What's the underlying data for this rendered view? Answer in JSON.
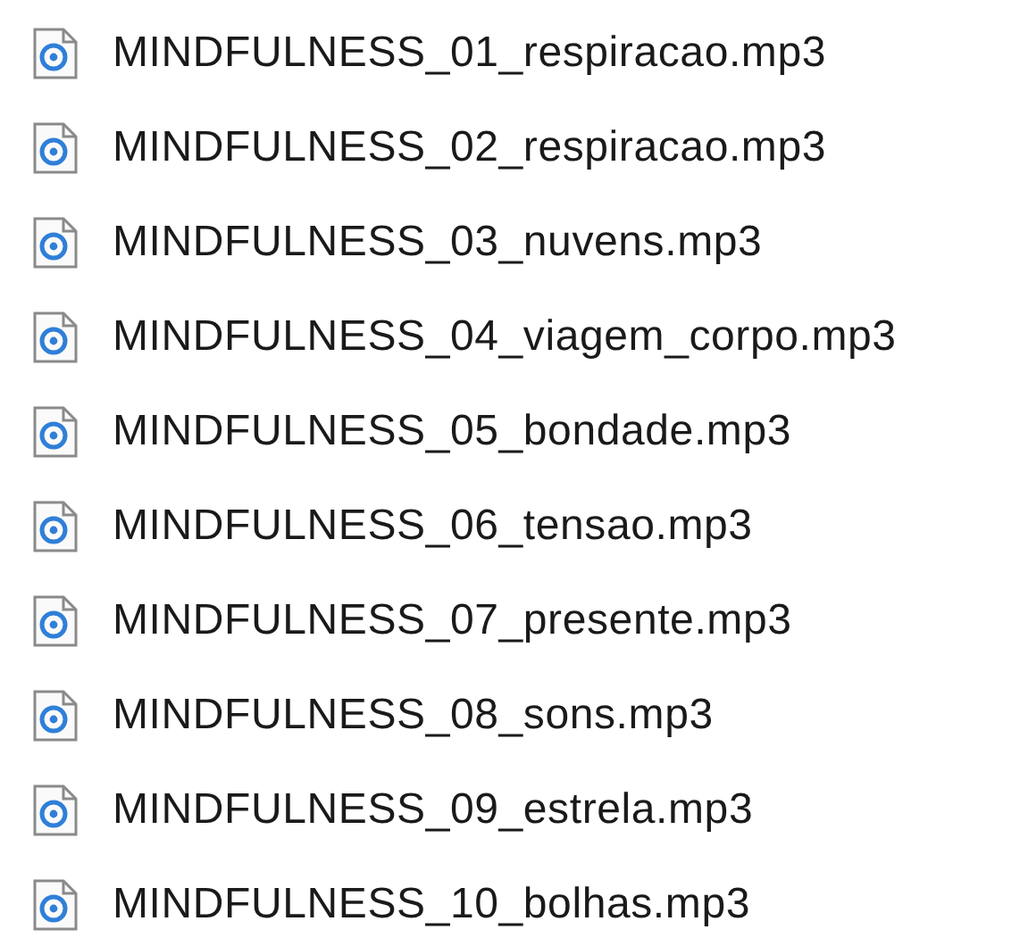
{
  "files": [
    {
      "name": "MINDFULNESS_01_respiracao.mp3"
    },
    {
      "name": "MINDFULNESS_02_respiracao.mp3"
    },
    {
      "name": "MINDFULNESS_03_nuvens.mp3"
    },
    {
      "name": "MINDFULNESS_04_viagem_corpo.mp3"
    },
    {
      "name": "MINDFULNESS_05_bondade.mp3"
    },
    {
      "name": "MINDFULNESS_06_tensao.mp3"
    },
    {
      "name": "MINDFULNESS_07_presente.mp3"
    },
    {
      "name": "MINDFULNESS_08_sons.mp3"
    },
    {
      "name": "MINDFULNESS_09_estrela.mp3"
    },
    {
      "name": "MINDFULNESS_10_bolhas.mp3"
    }
  ]
}
